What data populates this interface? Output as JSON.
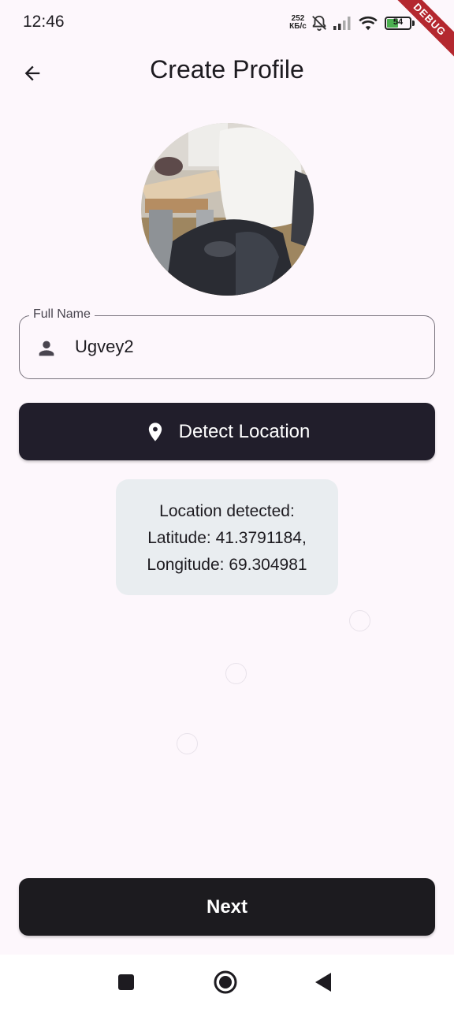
{
  "status_bar": {
    "time": "12:46",
    "net_speed_value": "252",
    "net_speed_unit": "КБ/с",
    "battery_level": "54",
    "battery_fraction": 0.54,
    "icons": [
      "mute-icon",
      "signal-icon",
      "wifi-icon",
      "battery-icon"
    ]
  },
  "debug_banner": "DEBUG",
  "app_bar": {
    "title": "Create Profile",
    "back_icon": "arrow-back-icon"
  },
  "form": {
    "full_name_label": "Full Name",
    "full_name_value": "Ugvey2",
    "full_name_icon": "person-icon"
  },
  "detect_button": {
    "label": "Detect Location",
    "icon": "location-pin-icon"
  },
  "location_card": {
    "line1": "Location detected:",
    "line2": "Latitude: 41.3791184,",
    "line3": "Longitude: 69.304981"
  },
  "next_button": {
    "label": "Next"
  },
  "nav_bar": {
    "icons": [
      "recents-icon",
      "home-icon",
      "back-icon"
    ]
  },
  "colors": {
    "background": "#FDF7FC",
    "button_dark": "#211E2B",
    "card_bg": "#E9EDF0",
    "battery_green": "#4CAF50",
    "debug_red": "#B4282F"
  }
}
